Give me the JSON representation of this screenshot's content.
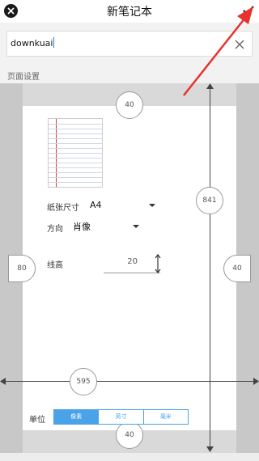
{
  "titlebar": {
    "title": "新笔记本",
    "close_icon": "close-icon",
    "confirm_icon": "check-icon"
  },
  "name_input": {
    "value": "downkuai",
    "clear_icon": "clear-icon"
  },
  "section_label": "页面设置",
  "page_setup": {
    "paper_size_label": "纸张尺寸",
    "paper_size_value": "A4",
    "orientation_label": "方向",
    "orientation_value": "肖像",
    "line_height_label": "线高",
    "line_height_value": "20"
  },
  "measures": {
    "top_margin": "40",
    "bottom_margin": "40",
    "left_margin": "80",
    "right_margin": "40",
    "height": "841",
    "width": "595"
  },
  "units": {
    "label": "单位",
    "options": [
      "像素",
      "英寸",
      "毫米"
    ],
    "selected": "像素"
  },
  "colors": {
    "accent": "#4aa3e8",
    "annotation": "#e8322c",
    "margin_line": "#d9383a"
  }
}
